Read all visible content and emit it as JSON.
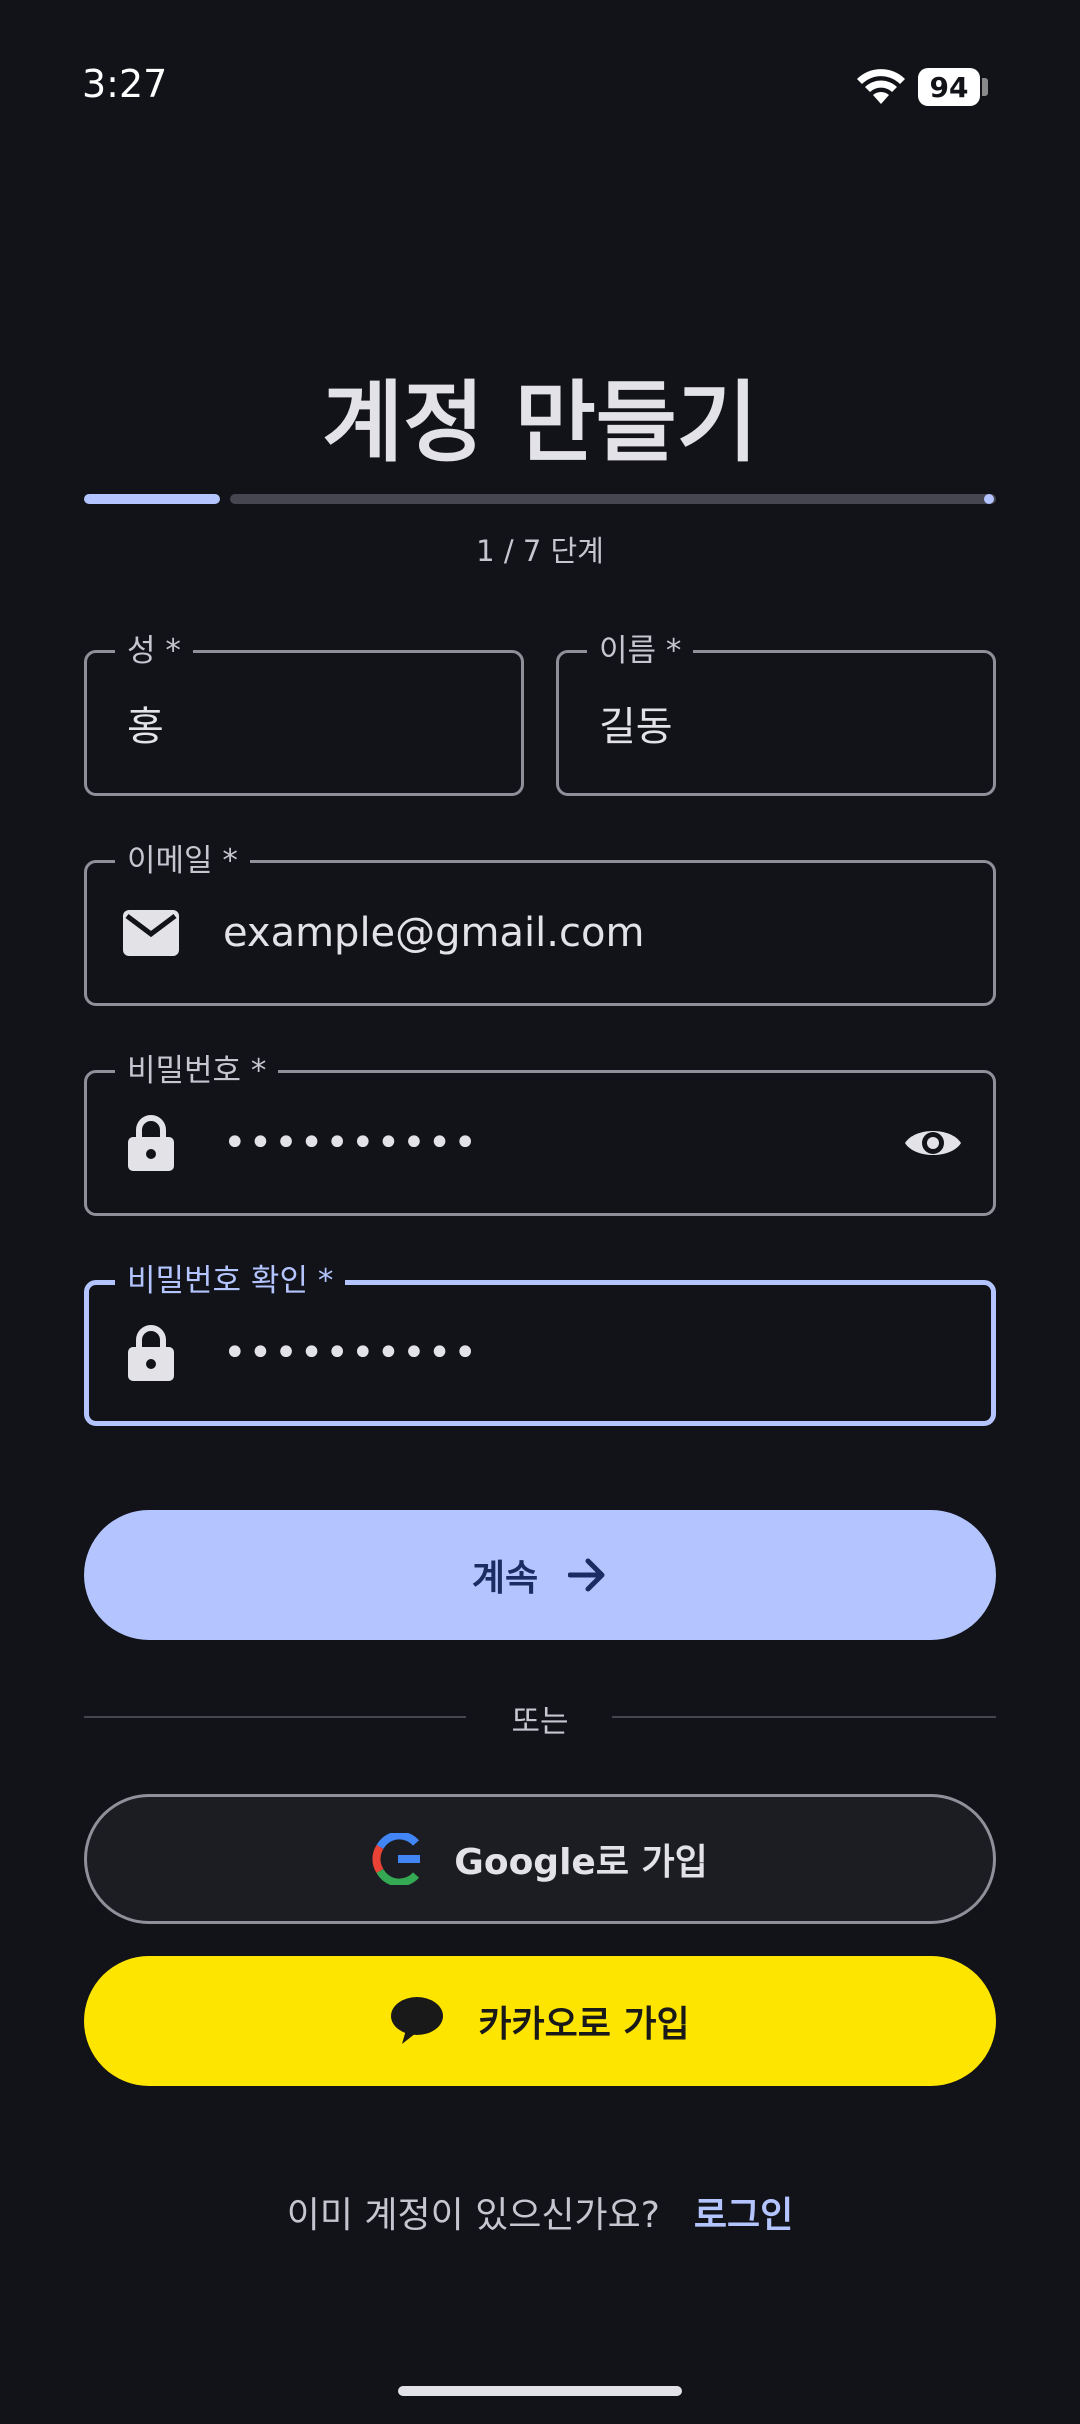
{
  "status_bar": {
    "time": "3:27",
    "battery": "94"
  },
  "header": {
    "title": "계정 만들기",
    "step": "1 / 7 단계",
    "progress_fraction": 0.14
  },
  "form": {
    "last_name": {
      "label": "성 *",
      "value": "홍"
    },
    "first_name": {
      "label": "이름 *",
      "value": "길동"
    },
    "email": {
      "label": "이메일 *",
      "value": "example@gmail.com"
    },
    "password": {
      "label": "비밀번호 *",
      "value": "••••••••••"
    },
    "confirm_password": {
      "label": "비밀번호 확인 *",
      "value": "••••••••••"
    }
  },
  "actions": {
    "continue_label": "계속",
    "divider_text": "또는",
    "google_label": "Google로 가입",
    "kakao_label": "카카오로 가입"
  },
  "footer": {
    "prompt": "이미 계정이 있으신가요?",
    "login_link": "로그인"
  },
  "colors": {
    "background": "#111318",
    "accent": "#b4c4ff",
    "kakao_yellow": "#fee500",
    "outline": "#8f909a"
  },
  "icons": [
    "wifi-icon",
    "mail-icon",
    "lock-icon",
    "eye-icon",
    "arrow-right-icon",
    "google-icon",
    "kakao-chat-icon"
  ]
}
